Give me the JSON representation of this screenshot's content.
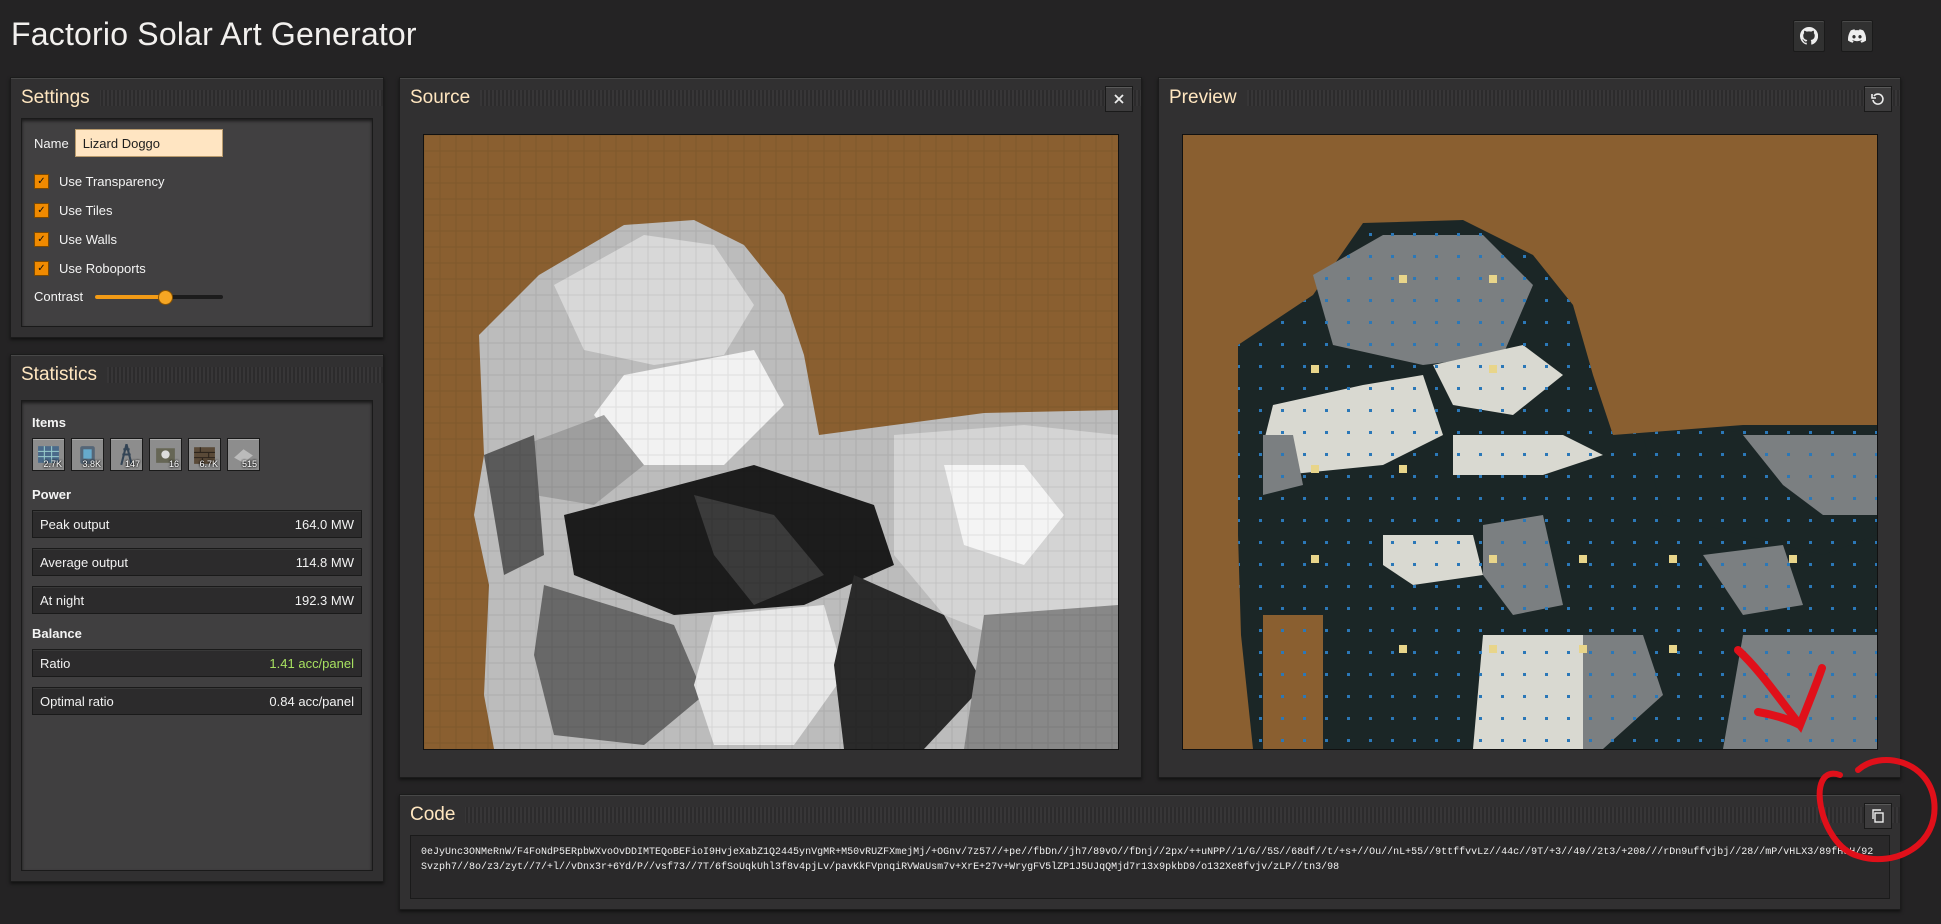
{
  "app": {
    "title": "Factorio Solar Art Generator",
    "icons": [
      "github-icon",
      "discord-icon"
    ]
  },
  "settings": {
    "title": "Settings",
    "name_label": "Name",
    "name_value": "Lizard Doggo",
    "options": [
      {
        "label": "Use Transparency",
        "checked": true
      },
      {
        "label": "Use Tiles",
        "checked": true
      },
      {
        "label": "Use Walls",
        "checked": true
      },
      {
        "label": "Use Roboports",
        "checked": true
      }
    ],
    "contrast_label": "Contrast",
    "contrast_level": 0.55
  },
  "statistics": {
    "title": "Statistics",
    "items_label": "Items",
    "items": [
      {
        "icon": "solar-panel-icon",
        "count": "2.7K"
      },
      {
        "icon": "accumulator-icon",
        "count": "3.8K"
      },
      {
        "icon": "substation-icon",
        "count": "147"
      },
      {
        "icon": "roboport-icon",
        "count": "16"
      },
      {
        "icon": "wall-icon",
        "count": "6.7K"
      },
      {
        "icon": "landfill-icon",
        "count": "515"
      }
    ],
    "power_label": "Power",
    "power": [
      {
        "label": "Peak output",
        "value": "164.0 MW"
      },
      {
        "label": "Average output",
        "value": "114.8 MW"
      },
      {
        "label": "At night",
        "value": "192.3 MW"
      }
    ],
    "balance_label": "Balance",
    "balance": [
      {
        "label": "Ratio",
        "value": "1.41 acc/panel",
        "color": "#a7e060"
      },
      {
        "label": "Optimal ratio",
        "value": "0.84 acc/panel"
      }
    ]
  },
  "source": {
    "title": "Source",
    "close_icon": "close-icon"
  },
  "preview": {
    "title": "Preview",
    "refresh_icon": "refresh-icon"
  },
  "code": {
    "title": "Code",
    "copy_icon": "copy-icon",
    "text": "0eJyUnc3ONMeRnW/F4FoNdP5ERpbWXvoOvDDIMTEQoBEFioI9HvjeXabZ1Q2445ynVgMR+M50vRUZFXmejMj/+OGnv/7z57//+pe//fbDn//jh7/89vO//fDnj//2px/++uNPP//1/G//5S//68df//t/+s+//Ou//nL+55//9ttffvvLz//44c//9T/+3//49//2t3/+208///rDn9uffvjbj//28//mP/vHLX3/89fH3H/92Svzph7//8o/z3/zyt//7/+l//vDnx3r+6Yd/P//vsf73//7T/6fSoUqkUhl3f8v4pjLv/pavKkFVpnqiRVWaUsm7v+XrE+27v+WrygFV5lZP1J5UJqQMjd7r13x9pkbD9/o132Xe8fvjv/zLP//tn3/98"
  },
  "colors": {
    "accent": "#f08a00",
    "panel_title": "#ffe6c0",
    "ratio_good": "#a7e060",
    "canvas_bg": "#8a5f30",
    "annotation": "#e0101a"
  }
}
